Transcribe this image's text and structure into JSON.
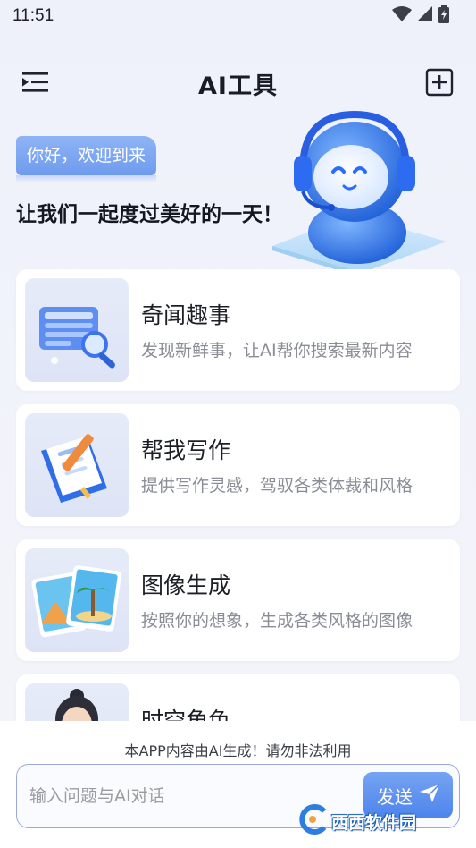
{
  "status_bar": {
    "time": "11:51",
    "icons": [
      "wifi-icon",
      "signal-icon",
      "battery-icon"
    ]
  },
  "header": {
    "title": "AI工具",
    "left_icon": "menu-collapse-icon",
    "right_icon": "add-square-icon"
  },
  "hero": {
    "greeting": "你好，欢迎到来",
    "slogan": "让我们一起度过美好的一天！",
    "illustration": "robot-headset-icon"
  },
  "cards": [
    {
      "title": "奇闻趣事",
      "desc": "发现新鲜事，让AI帮你搜索最新内容",
      "icon": "news-search-icon"
    },
    {
      "title": "帮我写作",
      "desc": "提供写作灵感，驾驭各类体裁和风格",
      "icon": "notebook-pen-icon"
    },
    {
      "title": "图像生成",
      "desc": "按照你的想象，生成各类风格的图像",
      "icon": "photo-cards-icon"
    },
    {
      "title": "时空角色",
      "desc": "",
      "icon": "character-avatar-icon"
    }
  ],
  "bottom": {
    "disclaimer": "本APP内容由AI生成！请勿非法利用",
    "input_placeholder": "输入问题与AI对话",
    "input_value": "",
    "send_label": "发送"
  },
  "watermark": {
    "text": "西西软件园"
  },
  "colors": {
    "accent": "#5b8ef0",
    "background": "#eef1fa",
    "card": "#ffffff",
    "muted_text": "#8a8d96"
  }
}
